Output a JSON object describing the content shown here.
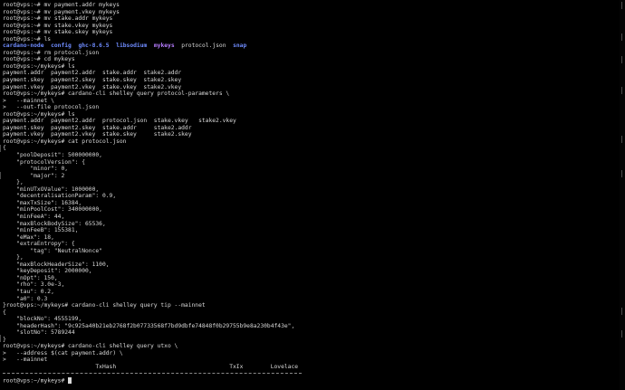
{
  "terminal": {
    "lines": [
      [
        {
          "t": "root@vps:~# mv payment.addr mykeys"
        }
      ],
      [
        {
          "t": "root@vps:~# mv payment.vkey mykeys"
        }
      ],
      [
        {
          "t": "root@vps:~# mv stake.addr mykeys"
        }
      ],
      [
        {
          "t": "root@vps:~# mv stake.vkey mykeys"
        }
      ],
      [
        {
          "t": "root@vps:~# mv stake.skey mykeys"
        }
      ],
      [
        {
          "t": "root@vps:~# ls"
        }
      ],
      [
        {
          "t": "cardano-node",
          "c": "blue"
        },
        {
          "t": "  "
        },
        {
          "t": "config",
          "c": "blue"
        },
        {
          "t": "  "
        },
        {
          "t": "ghc-8.6.5",
          "c": "blue"
        },
        {
          "t": "  "
        },
        {
          "t": "libsodium",
          "c": "blue"
        },
        {
          "t": "  "
        },
        {
          "t": "mykeys",
          "c": "purple"
        },
        {
          "t": "  protocol.json  "
        },
        {
          "t": "snap",
          "c": "blue"
        }
      ],
      [
        {
          "t": "root@vps:~# rm protocol.json"
        }
      ],
      [
        {
          "t": "root@vps:~# cd mykeys"
        }
      ],
      [
        {
          "t": "root@vps:~/mykeys# ls"
        }
      ],
      [
        {
          "t": "payment.addr  payment2.addr  stake.addr  stake2.addr"
        }
      ],
      [
        {
          "t": "payment.skey  payment2.skey  stake.skey  stake2.skey"
        }
      ],
      [
        {
          "t": "payment.vkey  payment2.vkey  stake.vkey  stake2.vkey"
        }
      ],
      [
        {
          "t": "root@vps:~/mykeys# cardano-cli shelley query protocol-parameters \\"
        }
      ],
      [
        {
          "t": ">   --mainnet \\"
        }
      ],
      [
        {
          "t": ">   --out-file protocol.json"
        }
      ],
      [
        {
          "t": "root@vps:~/mykeys# ls"
        }
      ],
      [
        {
          "t": "payment.addr  payment2.addr  protocol.json  stake.vkey   stake2.vkey"
        }
      ],
      [
        {
          "t": "payment.skey  payment2.skey  stake.addr     stake2.addr"
        }
      ],
      [
        {
          "t": "payment.vkey  payment2.vkey  stake.skey     stake2.skey"
        }
      ],
      [
        {
          "t": "root@vps:~/mykeys# cat protocol.json"
        }
      ],
      [
        {
          "t": "{"
        }
      ],
      [
        {
          "t": "    \"poolDeposit\": 500000000,"
        }
      ],
      [
        {
          "t": "    \"protocolVersion\": {"
        }
      ],
      [
        {
          "t": "        \"minor\": 0,"
        }
      ],
      [
        {
          "t": "        \"major\": 2"
        }
      ],
      [
        {
          "t": "    },"
        }
      ],
      [
        {
          "t": "    \"minUTxOValue\": 1000000,"
        }
      ],
      [
        {
          "t": "    \"decentralisationParam\": 0.9,"
        }
      ],
      [
        {
          "t": "    \"maxTxSize\": 16384,"
        }
      ],
      [
        {
          "t": "    \"minPoolCost\": 340000000,"
        }
      ],
      [
        {
          "t": "    \"minFeeA\": 44,"
        }
      ],
      [
        {
          "t": "    \"maxBlockBodySize\": 65536,"
        }
      ],
      [
        {
          "t": "    \"minFeeB\": 155381,"
        }
      ],
      [
        {
          "t": "    \"eMax\": 18,"
        }
      ],
      [
        {
          "t": "    \"extraEntropy\": {"
        }
      ],
      [
        {
          "t": "        \"tag\": \"NeutralNonce\""
        }
      ],
      [
        {
          "t": "    },"
        }
      ],
      [
        {
          "t": "    \"maxBlockHeaderSize\": 1100,"
        }
      ],
      [
        {
          "t": "    \"keyDeposit\": 2000000,"
        }
      ],
      [
        {
          "t": "    \"nOpt\": 150,"
        }
      ],
      [
        {
          "t": "    \"rho\": 3.0e-3,"
        }
      ],
      [
        {
          "t": "    \"tau\": 0.2,"
        }
      ],
      [
        {
          "t": "    \"a0\": 0.3"
        }
      ],
      [
        {
          "t": "}root@vps:~/mykeys# cardano-cli shelley query tip --mainnet"
        }
      ],
      [
        {
          "t": "{"
        }
      ],
      [
        {
          "t": "    \"blockNo\": 4555199,"
        }
      ],
      [
        {
          "t": "    \"headerHash\": \"9c925a40b21eb2768f2b07733568f7bd9dbfe74848f0b29755b9e8a230b4f43e\","
        }
      ],
      [
        {
          "t": "    \"slotNo\": 5789244"
        }
      ],
      [
        {
          "t": "}"
        }
      ],
      [
        {
          "t": "root@vps:~/mykeys# cardano-cli shelley query utxo \\"
        }
      ],
      [
        {
          "t": ">   --address $(cat payment.addr) \\"
        }
      ],
      [
        {
          "t": ">   --mainnet"
        }
      ],
      [
        {
          "t": "                           TxHash                                 TxIx        Lovelace"
        }
      ],
      [
        {
          "t": ""
        }
      ],
      [
        {
          "t": "root@vps:~/mykeys# "
        }
      ]
    ],
    "separator_after_line": 53
  },
  "colors": {
    "background": "#000000",
    "text": "#d9d9d9",
    "dir_blue": "#6f8cff",
    "dir_purple": "#b77dff"
  }
}
